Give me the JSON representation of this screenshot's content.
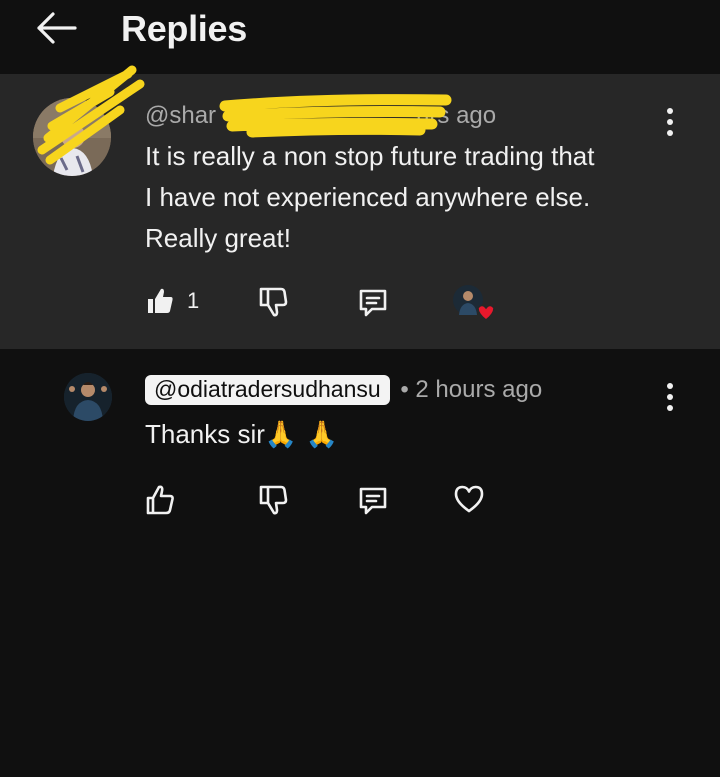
{
  "header": {
    "title": "Replies"
  },
  "parent_comment": {
    "author_visible": "@shar",
    "time_visible": "urs ago",
    "text_lines": [
      "It is really a non stop future trading that",
      "I have not experienced anywhere else.",
      "Really great!"
    ],
    "like_count": "1"
  },
  "reply": {
    "author": "@odiatradersudhansu",
    "time": "• 2 hours ago",
    "text": "Thanks sir",
    "emoji": "🙏 🙏"
  },
  "colors": {
    "background": "#101010",
    "highlight": "#272727",
    "text": "#f1f1f1",
    "meta": "#aaaaaa",
    "heart": "#e8182c",
    "redaction": "#f7d51d"
  },
  "icons": {
    "back": "arrow-left-icon",
    "like": "thumbs-up-icon",
    "dislike": "thumbs-down-icon",
    "reply": "comment-icon",
    "heart": "heart-icon",
    "more": "more-vertical-icon"
  }
}
